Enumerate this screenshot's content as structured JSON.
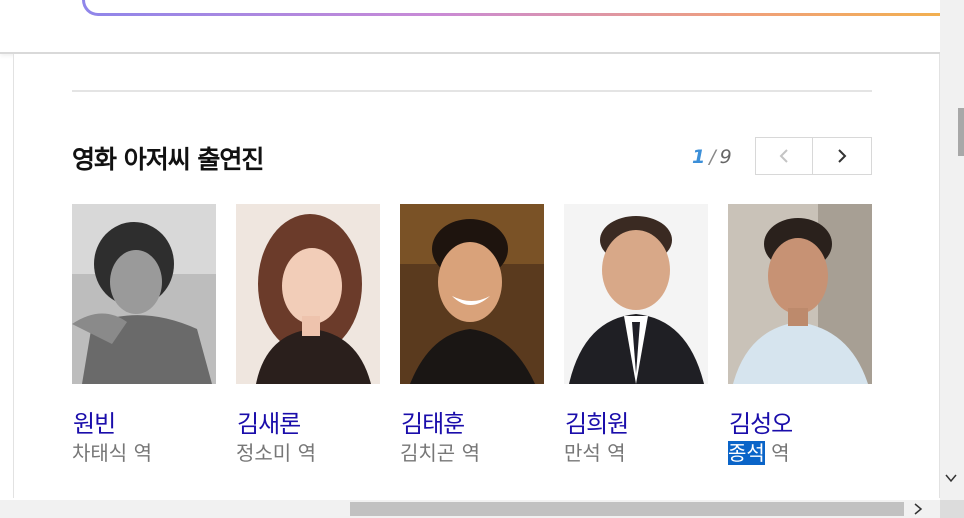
{
  "section": {
    "title": "영화 아저씨 출연진"
  },
  "pager": {
    "current": "1",
    "separator": "/",
    "total": "9"
  },
  "nav": {
    "prev_icon": "chevron-left-icon",
    "next_icon": "chevron-right-icon"
  },
  "cast": [
    {
      "name": "원빈",
      "role_name": "차태식",
      "role_suffix": "역"
    },
    {
      "name": "김새론",
      "role_name": "정소미",
      "role_suffix": "역"
    },
    {
      "name": "김태훈",
      "role_name": "김치곤",
      "role_suffix": "역"
    },
    {
      "name": "김희원",
      "role_name": "만석",
      "role_suffix": "역"
    },
    {
      "name": "김성오",
      "role_name": "종석",
      "role_suffix": "역",
      "role_selected": true
    }
  ],
  "colors": {
    "link": "#1a0dab",
    "pager_current": "#3c8fd8",
    "selection": "#0a64c8"
  }
}
